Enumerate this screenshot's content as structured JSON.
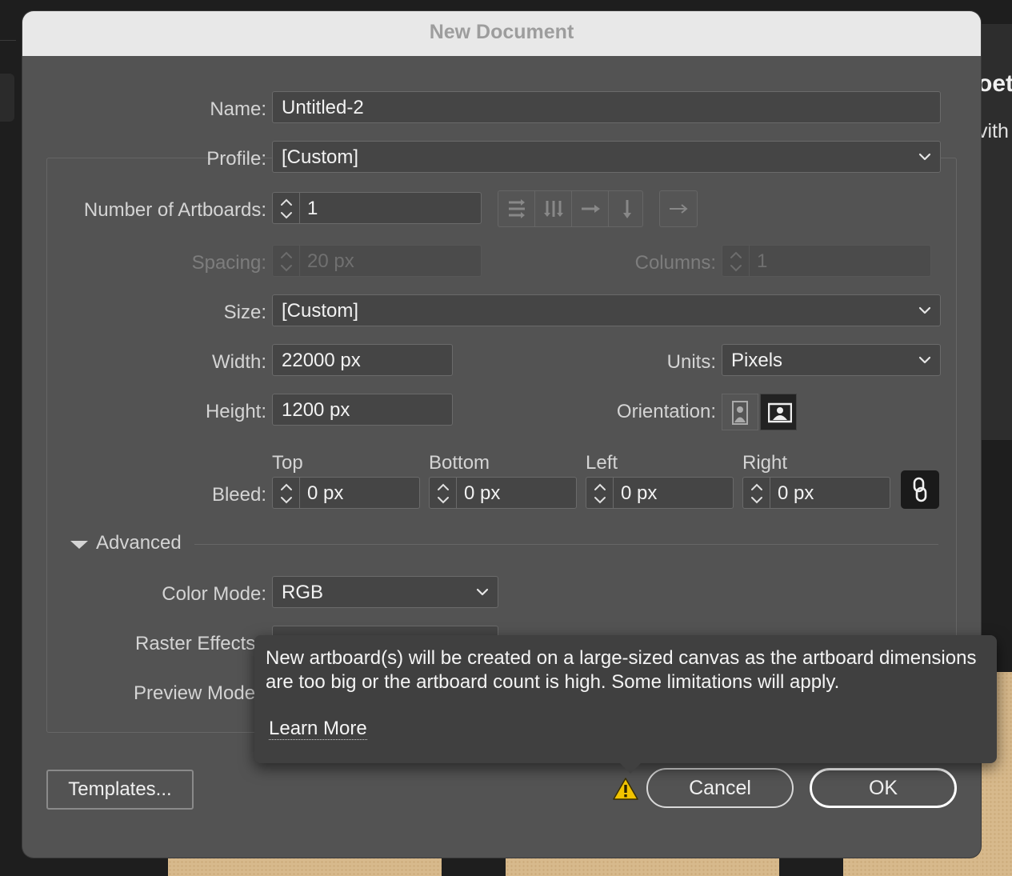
{
  "background": {
    "right_text_1": "oet",
    "right_text_2": "vith"
  },
  "dialog": {
    "title": "New Document",
    "name": {
      "label": "Name:",
      "value": "Untitled-2"
    },
    "profile": {
      "label": "Profile:",
      "value": "[Custom]"
    },
    "artboards": {
      "label": "Number of Artboards:",
      "value": "1"
    },
    "spacing": {
      "label": "Spacing:",
      "value": "20 px"
    },
    "columns": {
      "label": "Columns:",
      "value": "1"
    },
    "size": {
      "label": "Size:",
      "value": "[Custom]"
    },
    "width": {
      "label": "Width:",
      "value": "22000 px"
    },
    "units": {
      "label": "Units:",
      "value": "Pixels"
    },
    "height": {
      "label": "Height:",
      "value": "1200 px"
    },
    "orientation": {
      "label": "Orientation:"
    },
    "bleed": {
      "label": "Bleed:",
      "top": {
        "label": "Top",
        "value": "0 px"
      },
      "bottom": {
        "label": "Bottom",
        "value": "0 px"
      },
      "left": {
        "label": "Left",
        "value": "0 px"
      },
      "right": {
        "label": "Right",
        "value": "0 px"
      }
    },
    "advanced": {
      "label": "Advanced",
      "color_mode": {
        "label": "Color Mode:",
        "value": "RGB"
      },
      "raster_effects": {
        "label": "Raster Effects"
      },
      "preview_mode": {
        "label": "Preview Mode"
      }
    },
    "tooltip": {
      "text": "New artboard(s) will be created on a large-sized canvas as the artboard dimensions are too big or the artboard count is high. Some limitations will apply.",
      "link": "Learn More"
    },
    "buttons": {
      "templates": "Templates...",
      "cancel": "Cancel",
      "ok": "OK"
    }
  },
  "colors": {
    "dialog_bg": "#535353",
    "warning": "#f2c400",
    "titlebar": "#e8e8e8"
  }
}
